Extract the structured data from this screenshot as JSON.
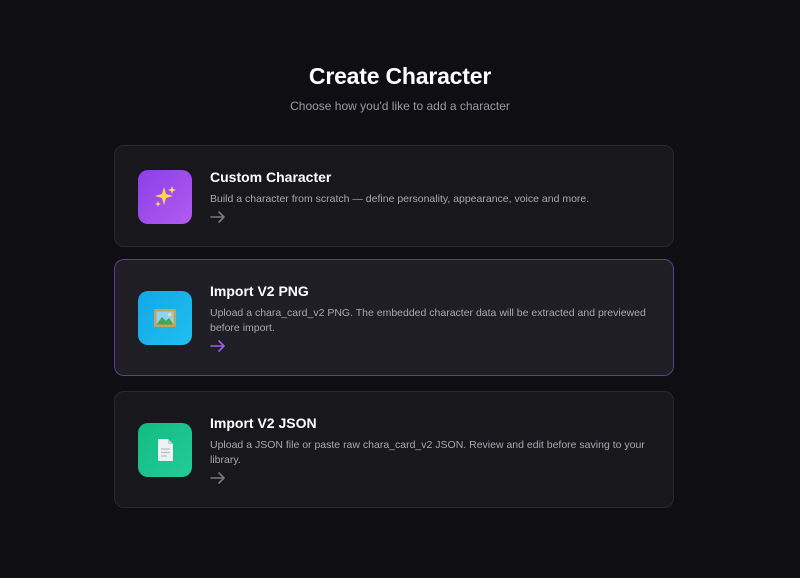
{
  "header": {
    "title": "Create Character",
    "subtitle": "Choose how you'd like to add a character"
  },
  "options": [
    {
      "title": "Custom Character",
      "description": "Build a character from scratch — define personality, appearance, voice and more.",
      "icon": "sparkles-icon",
      "tile_color": "#9b4dea",
      "arrow_color": "#7a7980"
    },
    {
      "title": "Import V2 PNG",
      "description": "Upload a chara_card_v2 PNG. The embedded character data will be extracted and previewed before import.",
      "icon": "framed-picture-icon",
      "tile_color": "#1bb0e8",
      "arrow_color": "#a35cf0"
    },
    {
      "title": "Import V2 JSON",
      "description": "Upload a JSON file or paste raw chara_card_v2 JSON. Review and edit before saving to your library.",
      "icon": "document-icon",
      "tile_color": "#19c389",
      "arrow_color": "#7a7980"
    }
  ]
}
